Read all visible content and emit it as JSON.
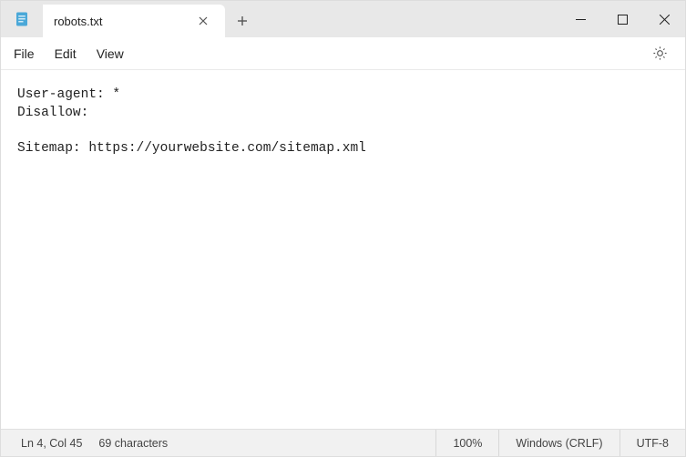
{
  "tab": {
    "title": "robots.txt"
  },
  "menu": {
    "file": "File",
    "edit": "Edit",
    "view": "View"
  },
  "editor": {
    "content": "User-agent: *\nDisallow:\n\nSitemap: https://yourwebsite.com/sitemap.xml"
  },
  "status": {
    "position": "Ln 4, Col 45",
    "chars": "69 characters",
    "zoom": "100%",
    "eol": "Windows (CRLF)",
    "encoding": "UTF-8"
  }
}
